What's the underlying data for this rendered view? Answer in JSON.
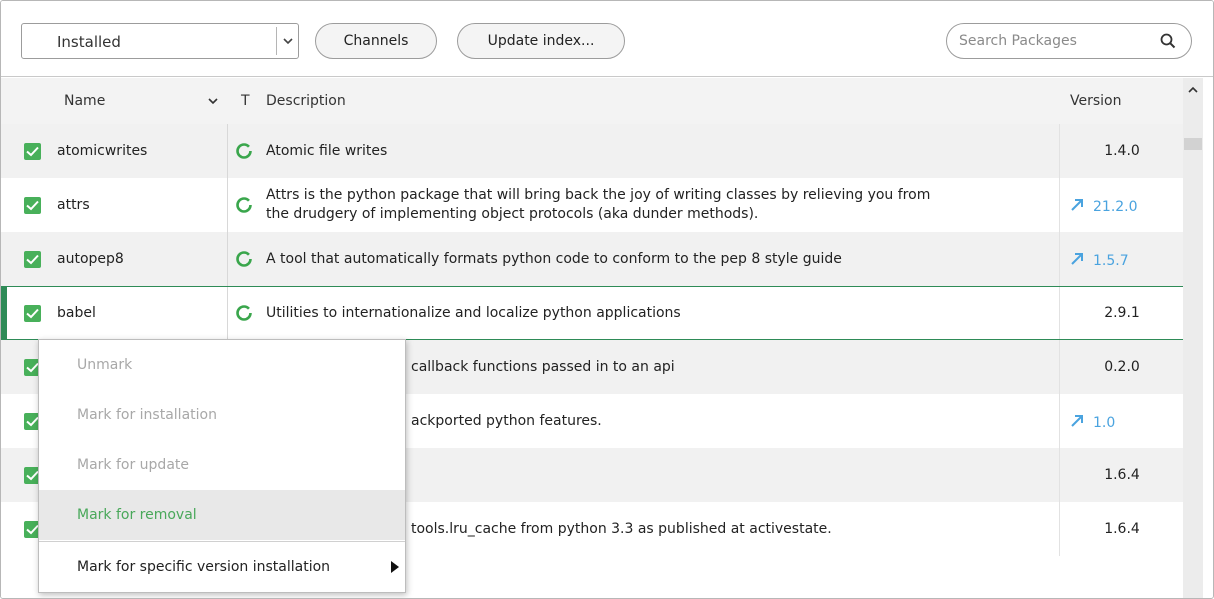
{
  "toolbar": {
    "filter_value": "Installed",
    "channels_label": "Channels",
    "update_index_label": "Update index...",
    "search_placeholder": "Search Packages"
  },
  "table": {
    "columns": {
      "name": "Name",
      "type": "T",
      "description": "Description",
      "version": "Version"
    },
    "rows": [
      {
        "name": "atomicwrites",
        "description": "Atomic file writes",
        "version": "1.4.0",
        "update": false
      },
      {
        "name": "attrs",
        "description_line1": "Attrs is the python package that will bring back the joy of writing classes by relieving you from",
        "description_line2": "the drudgery of implementing object protocols (aka dunder methods).",
        "version": "21.2.0",
        "update": true
      },
      {
        "name": "autopep8",
        "description": "A tool that automatically formats python code to conform to the pep 8 style guide",
        "version": "1.5.7",
        "update": true
      },
      {
        "name": "babel",
        "description": "Utilities to internationalize and localize python applications",
        "version": "2.9.1",
        "update": false
      },
      {
        "name": "",
        "description": "callback functions passed in to an api",
        "version": "0.2.0",
        "update": false
      },
      {
        "name": "",
        "description": "ackported python features.",
        "version": "1.0",
        "update": true
      },
      {
        "name": "",
        "description": "",
        "version": "1.6.4",
        "update": false
      },
      {
        "name": "",
        "description": "tools.lru_cache from python 3.3 as published at activestate.",
        "version": "1.6.4",
        "update": false
      }
    ]
  },
  "context_menu": {
    "items": [
      {
        "label": "Unmark",
        "state": "disabled"
      },
      {
        "label": "Mark for installation",
        "state": "disabled"
      },
      {
        "label": "Mark for update",
        "state": "disabled"
      },
      {
        "label": "Mark for removal",
        "state": "highlighted"
      },
      {
        "label": "Mark for specific version installation",
        "state": "normal"
      }
    ]
  },
  "colors": {
    "accent_green": "#48b05a",
    "update_blue": "#4aa3df",
    "selected_border": "#2e8b57"
  }
}
